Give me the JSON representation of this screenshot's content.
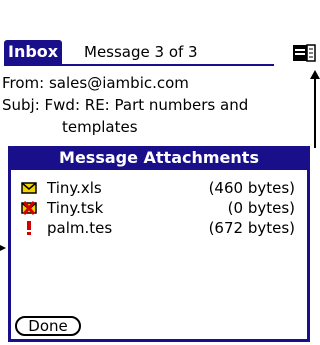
{
  "titlebar": {
    "app_title": "Inbox",
    "counter": "Message 3 of 3"
  },
  "header": {
    "from": "From: sales@iambic.com",
    "subj_line1": "Subj: Fwd: RE: Part numbers and",
    "subj_line2": "templates"
  },
  "dialog": {
    "title": "Message Attachments",
    "attachments": [
      {
        "name": "Tiny.xls",
        "size": "(460 bytes)",
        "icon": "envelope-icon"
      },
      {
        "name": "Tiny.tsk",
        "size": "(0 bytes)",
        "icon": "envelope-error-icon"
      },
      {
        "name": "palm.tes",
        "size": "(672 bytes)",
        "icon": "exclamation-icon"
      }
    ],
    "done_label": "Done"
  },
  "colors": {
    "accent": "#1a0f8a",
    "envelope": "#f2d400",
    "error": "#d40000"
  }
}
